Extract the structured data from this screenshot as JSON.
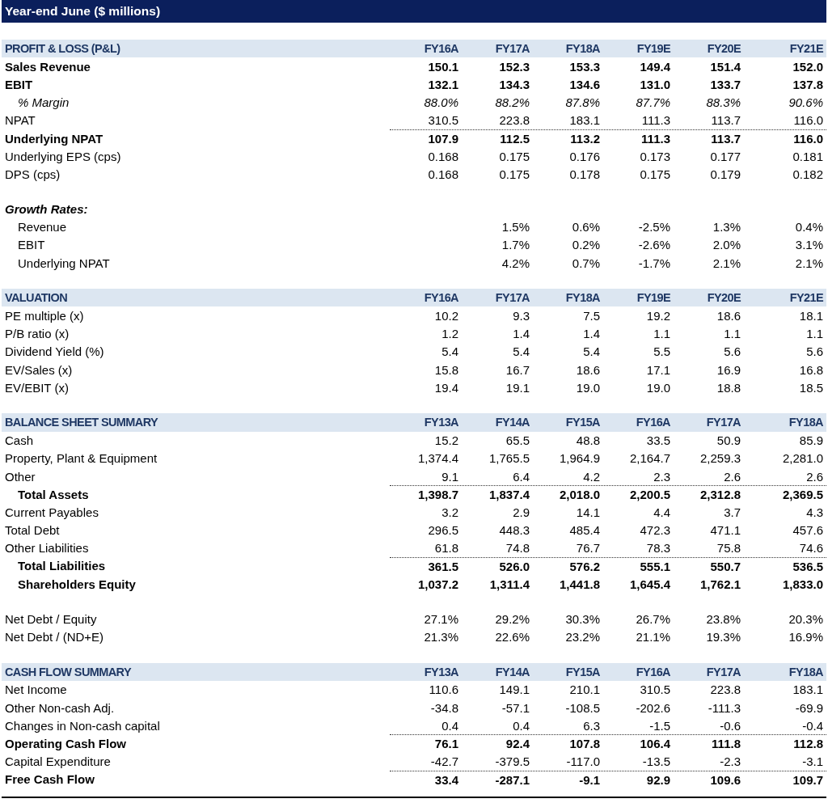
{
  "title": "Year-end June ($ millions)",
  "sections": [
    {
      "heading": "PROFIT & LOSS (P&L)",
      "columns": [
        "FY16A",
        "FY17A",
        "FY18A",
        "FY19E",
        "FY20E",
        "FY21E"
      ],
      "blocks": [
        [
          {
            "label": "Sales Revenue",
            "kind": "bold",
            "rule_above": false,
            "values": [
              "150.1",
              "152.3",
              "153.3",
              "149.4",
              "151.4",
              "152.0"
            ]
          },
          {
            "label": "EBIT",
            "kind": "bold",
            "rule_above": false,
            "values": [
              "132.1",
              "134.3",
              "134.6",
              "131.0",
              "133.7",
              "137.8"
            ]
          },
          {
            "label": "% Margin",
            "kind": "italic",
            "rule_above": false,
            "values": [
              "88.0%",
              "88.2%",
              "87.8%",
              "87.7%",
              "88.3%",
              "90.6%"
            ]
          },
          {
            "label": "NPAT",
            "kind": "normal",
            "rule_above": false,
            "values": [
              "310.5",
              "223.8",
              "183.1",
              "111.3",
              "113.7",
              "116.0"
            ]
          },
          {
            "label": "Underlying NPAT",
            "kind": "bold",
            "rule_above": true,
            "values": [
              "107.9",
              "112.5",
              "113.2",
              "111.3",
              "113.7",
              "116.0"
            ]
          },
          {
            "label": "Underlying EPS (cps)",
            "kind": "normal",
            "rule_above": false,
            "values": [
              "0.168",
              "0.175",
              "0.176",
              "0.173",
              "0.177",
              "0.181"
            ]
          },
          {
            "label": "DPS (cps)",
            "kind": "normal",
            "rule_above": false,
            "values": [
              "0.168",
              "0.175",
              "0.178",
              "0.175",
              "0.179",
              "0.182"
            ]
          }
        ],
        [
          {
            "label": "Growth Rates:",
            "kind": "bolditalic",
            "rule_above": false,
            "children": [
              {
                "label": "Revenue",
                "kind": "normal",
                "rule_above": false,
                "values": [
                  "1.5%",
                  "0.6%",
                  "-2.5%",
                  "1.3%",
                  "0.4%"
                ]
              },
              {
                "label": "EBIT",
                "kind": "normal",
                "rule_above": false,
                "values": [
                  "1.7%",
                  "0.2%",
                  "-2.6%",
                  "2.0%",
                  "3.1%"
                ]
              },
              {
                "label": "Underlying NPAT",
                "kind": "normal",
                "rule_above": false,
                "values": [
                  "4.2%",
                  "0.7%",
                  "-1.7%",
                  "2.1%",
                  "2.1%"
                ]
              }
            ]
          }
        ]
      ]
    },
    {
      "heading": "VALUATION",
      "columns": [
        "FY16A",
        "FY17A",
        "FY18A",
        "FY19E",
        "FY20E",
        "FY21E"
      ],
      "blocks": [
        [
          {
            "label": "PE multiple (x)",
            "kind": "normal",
            "rule_above": false,
            "values": [
              "10.2",
              "9.3",
              "7.5",
              "19.2",
              "18.6",
              "18.1"
            ]
          },
          {
            "label": "P/B ratio (x)",
            "kind": "normal",
            "rule_above": false,
            "values": [
              "1.2",
              "1.4",
              "1.4",
              "1.1",
              "1.1",
              "1.1"
            ]
          },
          {
            "label": "Dividend Yield (%)",
            "kind": "normal",
            "rule_above": false,
            "values": [
              "5.4",
              "5.4",
              "5.4",
              "5.5",
              "5.6",
              "5.6"
            ]
          },
          {
            "label": "EV/Sales (x)",
            "kind": "normal",
            "rule_above": false,
            "values": [
              "15.8",
              "16.7",
              "18.6",
              "17.1",
              "16.9",
              "16.8"
            ]
          },
          {
            "label": "EV/EBIT (x)",
            "kind": "normal",
            "rule_above": false,
            "values": [
              "19.4",
              "19.1",
              "19.0",
              "19.0",
              "18.8",
              "18.5"
            ]
          }
        ]
      ]
    },
    {
      "heading": "BALANCE SHEET SUMMARY",
      "columns": [
        "FY13A",
        "FY14A",
        "FY15A",
        "FY16A",
        "FY17A",
        "FY18A"
      ],
      "blocks": [
        [
          {
            "label": "Cash",
            "kind": "normal",
            "rule_above": false,
            "values": [
              "15.2",
              "65.5",
              "48.8",
              "33.5",
              "50.9",
              "85.9"
            ]
          },
          {
            "label": "Property, Plant & Equipment",
            "kind": "normal",
            "rule_above": false,
            "values": [
              "1,374.4",
              "1,765.5",
              "1,964.9",
              "2,164.7",
              "2,259.3",
              "2,281.0"
            ]
          },
          {
            "label": "Other",
            "kind": "normal",
            "rule_above": false,
            "values": [
              "9.1",
              "6.4",
              "4.2",
              "2.3",
              "2.6",
              "2.6"
            ]
          },
          {
            "label": "Total Assets",
            "kind": "total",
            "rule_above": true,
            "values": [
              "1,398.7",
              "1,837.4",
              "2,018.0",
              "2,200.5",
              "2,312.8",
              "2,369.5"
            ]
          },
          {
            "label": "Current Payables",
            "kind": "normal",
            "rule_above": false,
            "values": [
              "3.2",
              "2.9",
              "14.1",
              "4.4",
              "3.7",
              "4.3"
            ]
          },
          {
            "label": "Total Debt",
            "kind": "normal",
            "rule_above": false,
            "values": [
              "296.5",
              "448.3",
              "485.4",
              "472.3",
              "471.1",
              "457.6"
            ]
          },
          {
            "label": "Other Liabilities",
            "kind": "normal",
            "rule_above": false,
            "values": [
              "61.8",
              "74.8",
              "76.7",
              "78.3",
              "75.8",
              "74.6"
            ]
          },
          {
            "label": "Total Liabilities",
            "kind": "total",
            "rule_above": true,
            "values": [
              "361.5",
              "526.0",
              "576.2",
              "555.1",
              "550.7",
              "536.5"
            ]
          },
          {
            "label": "Shareholders Equity",
            "kind": "total",
            "rule_above": false,
            "values": [
              "1,037.2",
              "1,311.4",
              "1,441.8",
              "1,645.4",
              "1,762.1",
              "1,833.0"
            ]
          }
        ],
        [
          {
            "label": "Net Debt / Equity",
            "kind": "normal",
            "rule_above": false,
            "values": [
              "27.1%",
              "29.2%",
              "30.3%",
              "26.7%",
              "23.8%",
              "20.3%"
            ]
          },
          {
            "label": "Net Debt / (ND+E)",
            "kind": "normal",
            "rule_above": false,
            "values": [
              "21.3%",
              "22.6%",
              "23.2%",
              "21.1%",
              "19.3%",
              "16.9%"
            ]
          }
        ]
      ]
    },
    {
      "heading": "CASH FLOW SUMMARY",
      "columns": [
        "FY13A",
        "FY14A",
        "FY15A",
        "FY16A",
        "FY17A",
        "FY18A"
      ],
      "blocks": [
        [
          {
            "label": "Net Income",
            "kind": "normal",
            "rule_above": false,
            "values": [
              "110.6",
              "149.1",
              "210.1",
              "310.5",
              "223.8",
              "183.1"
            ]
          },
          {
            "label": "Other Non-cash Adj.",
            "kind": "normal",
            "rule_above": false,
            "values": [
              "-34.8",
              "-57.1",
              "-108.5",
              "-202.6",
              "-111.3",
              "-69.9"
            ]
          },
          {
            "label": "Changes in Non-cash capital",
            "kind": "normal",
            "rule_above": false,
            "values": [
              "0.4",
              "0.4",
              "6.3",
              "-1.5",
              "-0.6",
              "-0.4"
            ]
          },
          {
            "label": "Operating Cash Flow",
            "kind": "bold",
            "rule_above": true,
            "values": [
              "76.1",
              "92.4",
              "107.8",
              "106.4",
              "111.8",
              "112.8"
            ]
          },
          {
            "label": "Capital Expenditure",
            "kind": "normal",
            "rule_above": false,
            "values": [
              "-42.7",
              "-379.5",
              "-117.0",
              "-13.5",
              "-2.3",
              "-3.1"
            ]
          },
          {
            "label": "Free Cash Flow",
            "kind": "bold",
            "rule_above": true,
            "values": [
              "33.4",
              "-287.1",
              "-9.1",
              "92.9",
              "109.6",
              "109.7"
            ]
          }
        ]
      ]
    }
  ]
}
